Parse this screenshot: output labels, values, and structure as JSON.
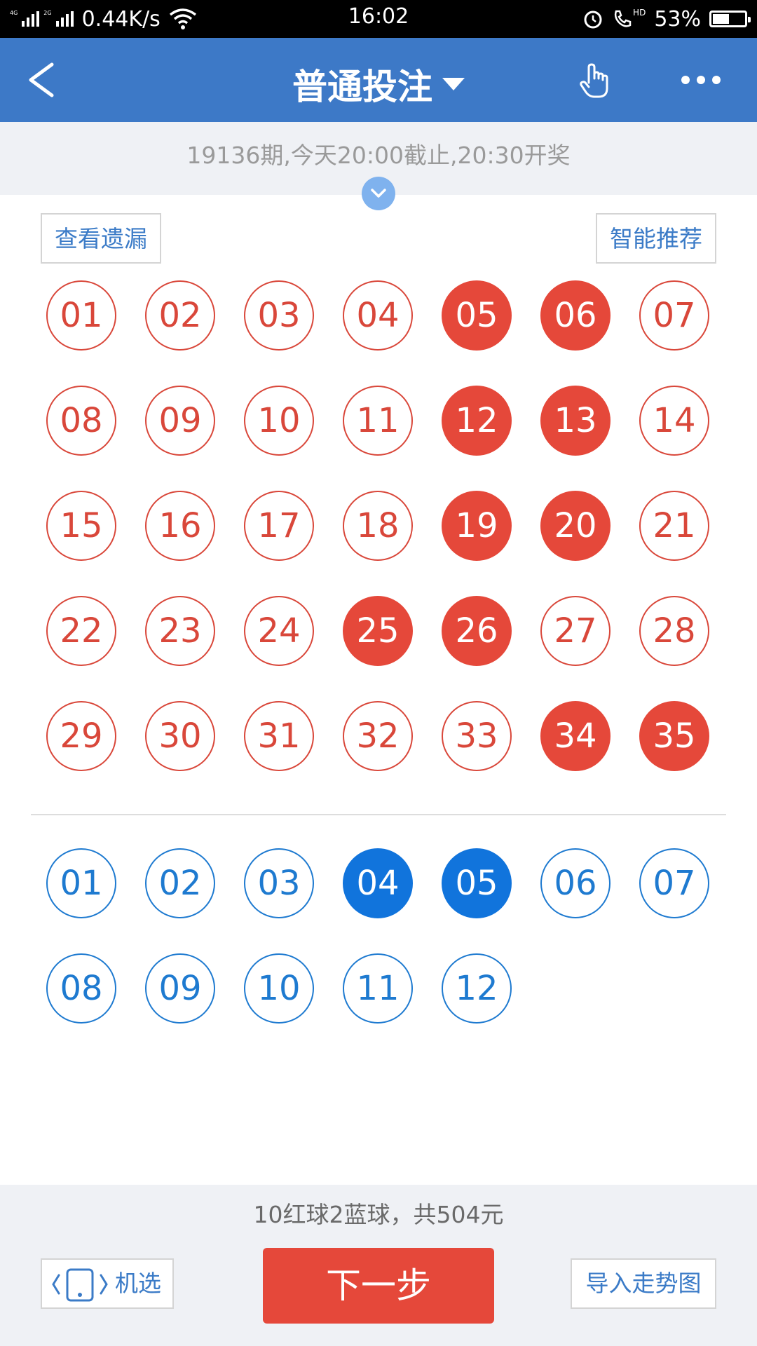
{
  "status_bar": {
    "network1": "4G",
    "network2": "2G",
    "speed": "0.44K/s",
    "time": "16:02",
    "hd": "HD",
    "battery_percent": "53%",
    "battery_level": 0.53,
    "icons": [
      "signal-icon",
      "wifi-icon",
      "alarm-icon",
      "call-icon",
      "battery-icon"
    ]
  },
  "header": {
    "title": "普通投注",
    "icons": [
      "back-arrow-icon",
      "dropdown-caret-icon",
      "hand-pointer-icon",
      "more-icon"
    ]
  },
  "info": {
    "text": "19136期,今天20:00截止,20:30开奖"
  },
  "buttons": {
    "view_missing": "查看遗漏",
    "smart_recommend": "智能推荐",
    "machine_pick": "机选",
    "next_step": "下一步",
    "import_trend": "导入走势图"
  },
  "red_balls": {
    "numbers": [
      "01",
      "02",
      "03",
      "04",
      "05",
      "06",
      "07",
      "08",
      "09",
      "10",
      "11",
      "12",
      "13",
      "14",
      "15",
      "16",
      "17",
      "18",
      "19",
      "20",
      "21",
      "22",
      "23",
      "24",
      "25",
      "26",
      "27",
      "28",
      "29",
      "30",
      "31",
      "32",
      "33",
      "34",
      "35"
    ],
    "selected": [
      "05",
      "06",
      "12",
      "13",
      "19",
      "20",
      "25",
      "26",
      "34",
      "35"
    ]
  },
  "blue_balls": {
    "numbers": [
      "01",
      "02",
      "03",
      "04",
      "05",
      "06",
      "07",
      "08",
      "09",
      "10",
      "11",
      "12"
    ],
    "selected": [
      "04",
      "05"
    ]
  },
  "summary": "10红球2蓝球，共504元",
  "colors": {
    "header_blue": "#3d79c7",
    "red": "#e5483a",
    "blue": "#1174dc"
  }
}
